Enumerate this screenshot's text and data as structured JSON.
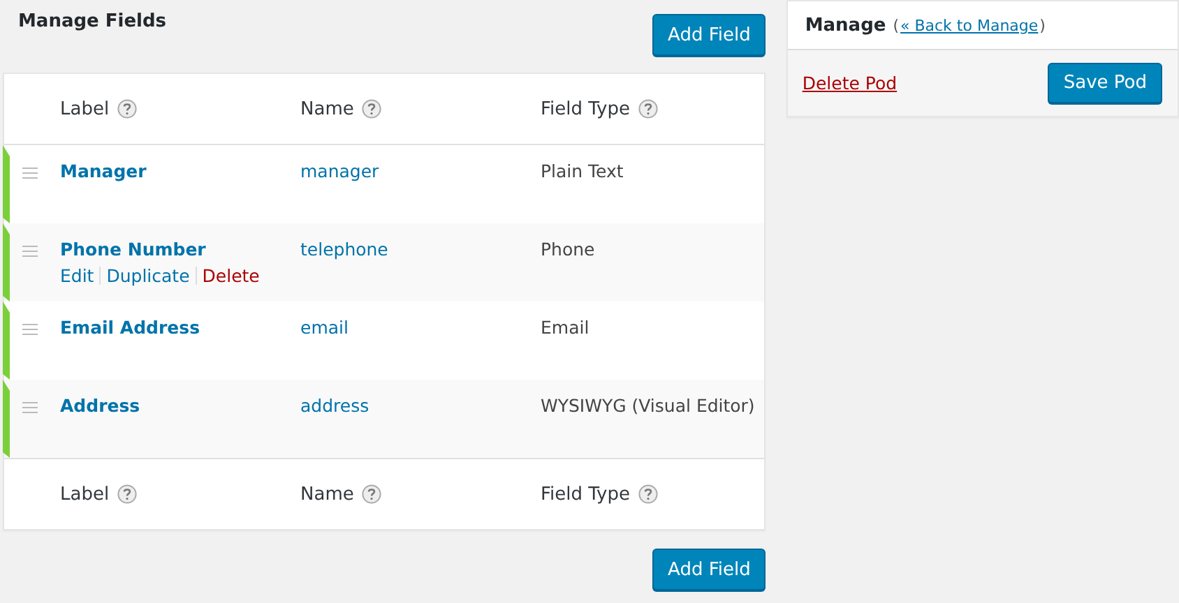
{
  "title": "Manage Fields",
  "add_button": "Add Field",
  "columns": [
    "Label",
    "Name",
    "Field Type"
  ],
  "fields": [
    {
      "label": "Manager",
      "name": "manager",
      "type": "Plain Text"
    },
    {
      "label": "Phone Number",
      "name": "telephone",
      "type": "Phone",
      "actions": [
        {
          "label": "Edit",
          "kind": "normal"
        },
        {
          "label": "Duplicate",
          "kind": "normal"
        },
        {
          "label": "Delete",
          "kind": "danger"
        }
      ]
    },
    {
      "label": "Email Address",
      "name": "email",
      "type": "Email"
    },
    {
      "label": "Address",
      "name": "address",
      "type": "WYSIWYG (Visual Editor)"
    }
  ],
  "footer_columns": [
    "Label",
    "Name",
    "Field Type"
  ],
  "bottom_button": "Add Field",
  "side_panel": {
    "heading": "Manage",
    "paren_open": "(",
    "link": "« Back to Manage",
    "paren_close": ")",
    "delete_link": "Delete Pod",
    "save_button": "Save Pod"
  }
}
